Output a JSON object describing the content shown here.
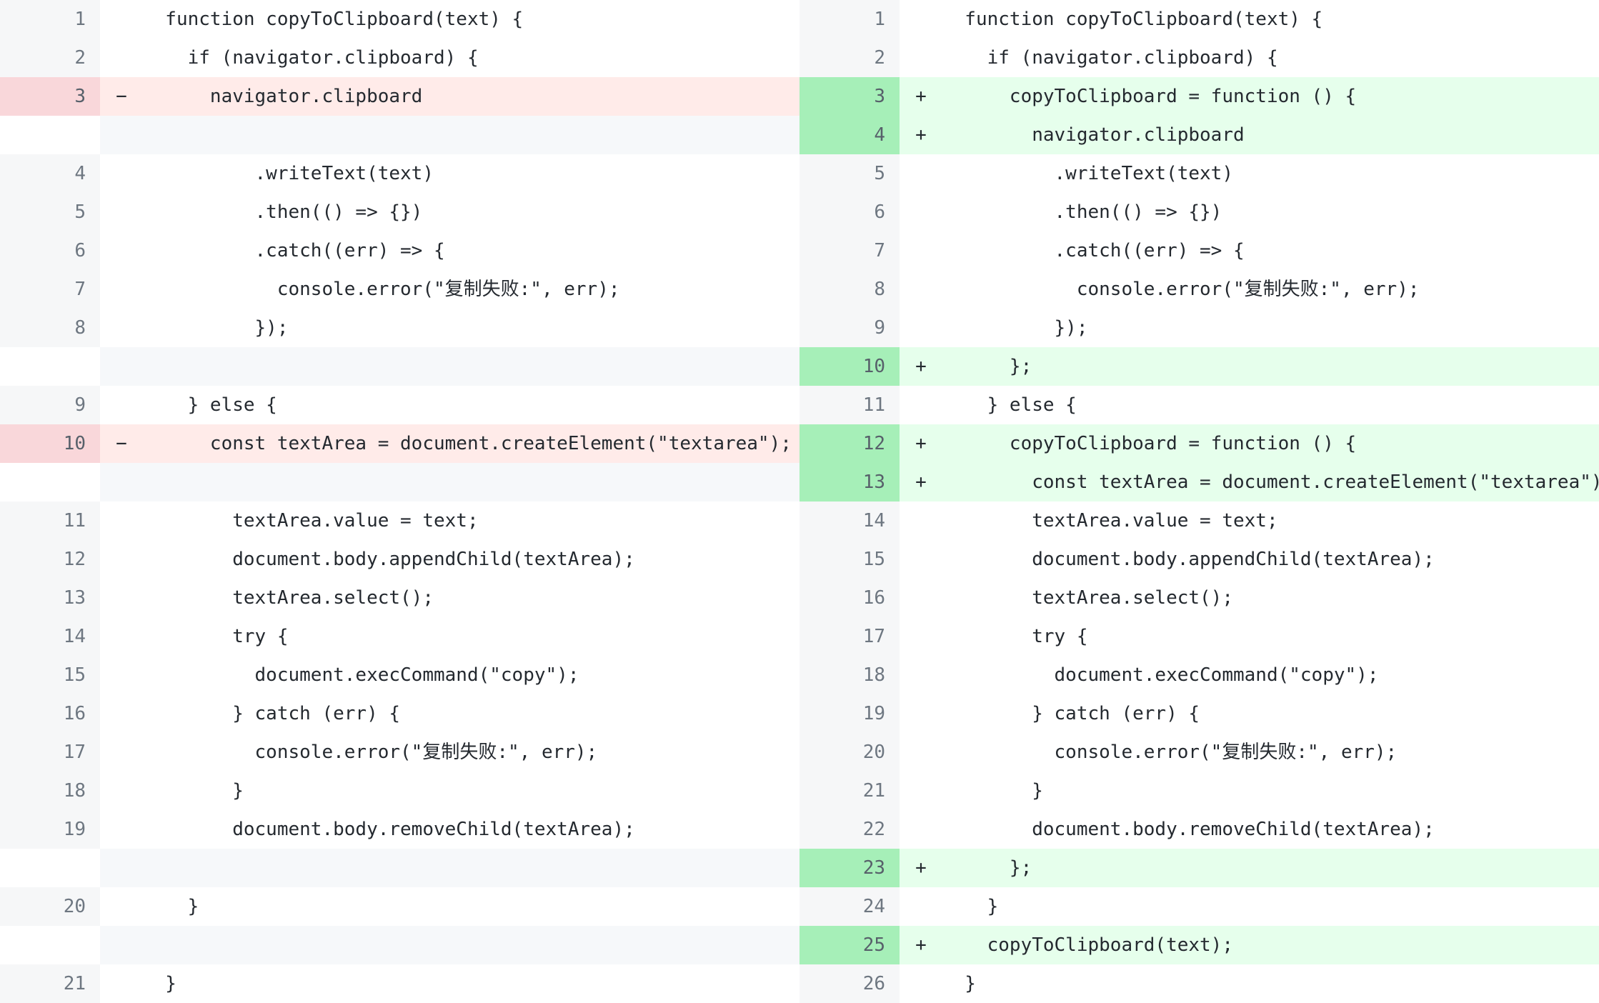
{
  "left": [
    {
      "type": "ctx",
      "num": "1",
      "sign": "",
      "code": "  function copyToClipboard(text) {"
    },
    {
      "type": "ctx",
      "num": "2",
      "sign": "",
      "code": "    if (navigator.clipboard) {"
    },
    {
      "type": "del",
      "num": "3",
      "sign": "−",
      "code": "      navigator.clipboard"
    },
    {
      "type": "empty",
      "num": "",
      "sign": "",
      "code": ""
    },
    {
      "type": "ctx",
      "num": "4",
      "sign": "",
      "code": "          .writeText(text)"
    },
    {
      "type": "ctx",
      "num": "5",
      "sign": "",
      "code": "          .then(() => {})"
    },
    {
      "type": "ctx",
      "num": "6",
      "sign": "",
      "code": "          .catch((err) => {"
    },
    {
      "type": "ctx",
      "num": "7",
      "sign": "",
      "code": "            console.error(\"复制失败:\", err);"
    },
    {
      "type": "ctx",
      "num": "8",
      "sign": "",
      "code": "          });"
    },
    {
      "type": "empty",
      "num": "",
      "sign": "",
      "code": ""
    },
    {
      "type": "ctx",
      "num": "9",
      "sign": "",
      "code": "    } else {"
    },
    {
      "type": "del",
      "num": "10",
      "sign": "−",
      "code": "      const textArea = document.createElement(\"textarea\");"
    },
    {
      "type": "empty",
      "num": "",
      "sign": "",
      "code": ""
    },
    {
      "type": "ctx",
      "num": "11",
      "sign": "",
      "code": "        textArea.value = text;"
    },
    {
      "type": "ctx",
      "num": "12",
      "sign": "",
      "code": "        document.body.appendChild(textArea);"
    },
    {
      "type": "ctx",
      "num": "13",
      "sign": "",
      "code": "        textArea.select();"
    },
    {
      "type": "ctx",
      "num": "14",
      "sign": "",
      "code": "        try {"
    },
    {
      "type": "ctx",
      "num": "15",
      "sign": "",
      "code": "          document.execCommand(\"copy\");"
    },
    {
      "type": "ctx",
      "num": "16",
      "sign": "",
      "code": "        } catch (err) {"
    },
    {
      "type": "ctx",
      "num": "17",
      "sign": "",
      "code": "          console.error(\"复制失败:\", err);"
    },
    {
      "type": "ctx",
      "num": "18",
      "sign": "",
      "code": "        }"
    },
    {
      "type": "ctx",
      "num": "19",
      "sign": "",
      "code": "        document.body.removeChild(textArea);"
    },
    {
      "type": "empty",
      "num": "",
      "sign": "",
      "code": ""
    },
    {
      "type": "ctx",
      "num": "20",
      "sign": "",
      "code": "    }"
    },
    {
      "type": "empty",
      "num": "",
      "sign": "",
      "code": ""
    },
    {
      "type": "ctx",
      "num": "21",
      "sign": "",
      "code": "  }"
    }
  ],
  "right": [
    {
      "type": "ctx",
      "num": "1",
      "sign": "",
      "code": "  function copyToClipboard(text) {"
    },
    {
      "type": "ctx",
      "num": "2",
      "sign": "",
      "code": "    if (navigator.clipboard) {"
    },
    {
      "type": "add",
      "num": "3",
      "sign": "+",
      "code": "      copyToClipboard = function () {"
    },
    {
      "type": "add",
      "num": "4",
      "sign": "+",
      "code": "        navigator.clipboard"
    },
    {
      "type": "ctx",
      "num": "5",
      "sign": "",
      "code": "          .writeText(text)"
    },
    {
      "type": "ctx",
      "num": "6",
      "sign": "",
      "code": "          .then(() => {})"
    },
    {
      "type": "ctx",
      "num": "7",
      "sign": "",
      "code": "          .catch((err) => {"
    },
    {
      "type": "ctx",
      "num": "8",
      "sign": "",
      "code": "            console.error(\"复制失败:\", err);"
    },
    {
      "type": "ctx",
      "num": "9",
      "sign": "",
      "code": "          });"
    },
    {
      "type": "add",
      "num": "10",
      "sign": "+",
      "code": "      };"
    },
    {
      "type": "ctx",
      "num": "11",
      "sign": "",
      "code": "    } else {"
    },
    {
      "type": "add",
      "num": "12",
      "sign": "+",
      "code": "      copyToClipboard = function () {"
    },
    {
      "type": "add",
      "num": "13",
      "sign": "+",
      "code": "        const textArea = document.createElement(\"textarea\");"
    },
    {
      "type": "ctx",
      "num": "14",
      "sign": "",
      "code": "        textArea.value = text;"
    },
    {
      "type": "ctx",
      "num": "15",
      "sign": "",
      "code": "        document.body.appendChild(textArea);"
    },
    {
      "type": "ctx",
      "num": "16",
      "sign": "",
      "code": "        textArea.select();"
    },
    {
      "type": "ctx",
      "num": "17",
      "sign": "",
      "code": "        try {"
    },
    {
      "type": "ctx",
      "num": "18",
      "sign": "",
      "code": "          document.execCommand(\"copy\");"
    },
    {
      "type": "ctx",
      "num": "19",
      "sign": "",
      "code": "        } catch (err) {"
    },
    {
      "type": "ctx",
      "num": "20",
      "sign": "",
      "code": "          console.error(\"复制失败:\", err);"
    },
    {
      "type": "ctx",
      "num": "21",
      "sign": "",
      "code": "        }"
    },
    {
      "type": "ctx",
      "num": "22",
      "sign": "",
      "code": "        document.body.removeChild(textArea);"
    },
    {
      "type": "add",
      "num": "23",
      "sign": "+",
      "code": "      };"
    },
    {
      "type": "ctx",
      "num": "24",
      "sign": "",
      "code": "    }"
    },
    {
      "type": "add",
      "num": "25",
      "sign": "+",
      "code": "    copyToClipboard(text);"
    },
    {
      "type": "ctx",
      "num": "26",
      "sign": "",
      "code": "  }"
    }
  ]
}
